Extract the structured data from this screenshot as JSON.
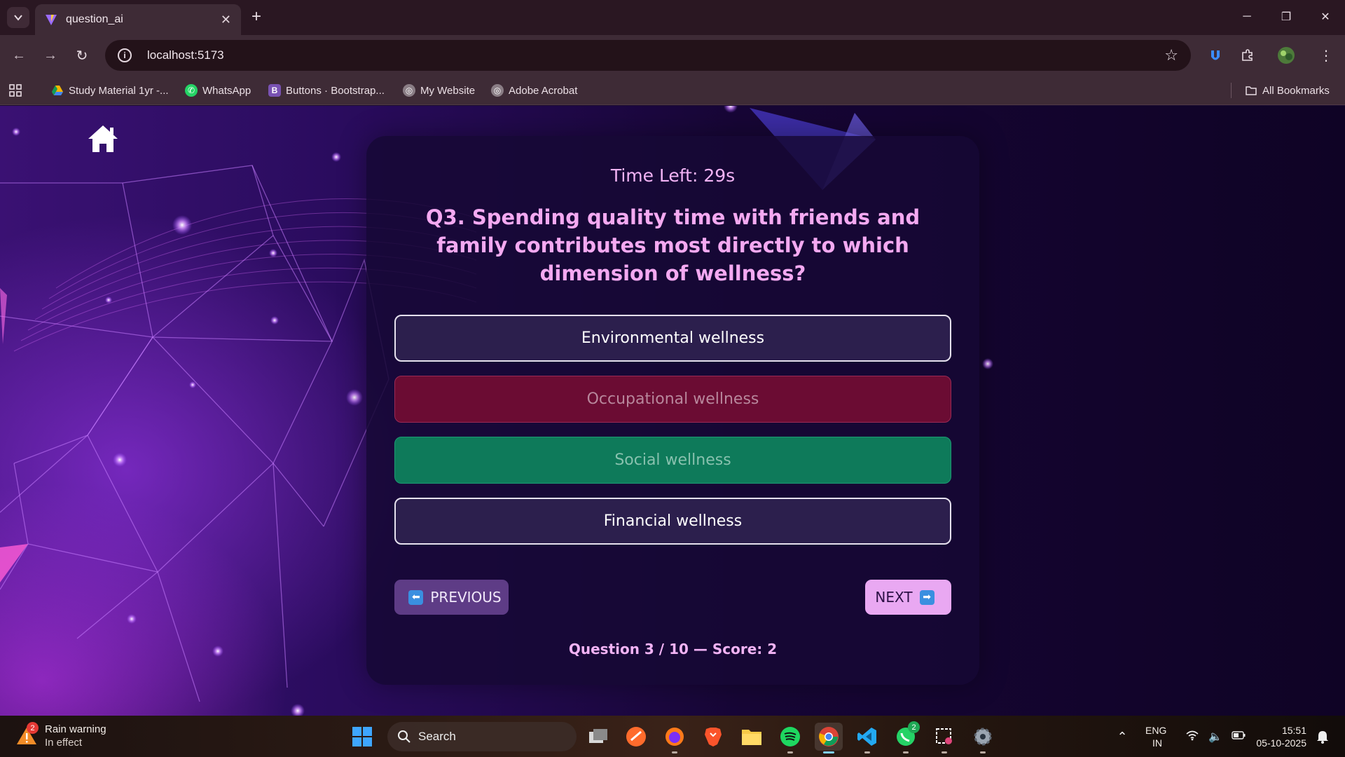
{
  "browser": {
    "tab_title": "question_ai",
    "url": "localhost:5173",
    "bookmarks": [
      "Study Material 1yr -...",
      "WhatsApp",
      "Buttons · Bootstrap...",
      "My Website",
      "Adobe Acrobat"
    ],
    "all_bookmarks_label": "All Bookmarks"
  },
  "quiz": {
    "timer": "Time Left: 29s",
    "question": "Q3. Spending quality time with friends and family contributes most directly to which dimension of wellness?",
    "options": [
      {
        "label": "Environmental wellness",
        "state": "neutral"
      },
      {
        "label": "Occupational wellness",
        "state": "wrong"
      },
      {
        "label": "Social wellness",
        "state": "correct"
      },
      {
        "label": "Financial wellness",
        "state": "neutral"
      }
    ],
    "prev_label": "PREVIOUS",
    "next_label": "NEXT",
    "progress": "Question 3 / 10 — Score: 2"
  },
  "taskbar": {
    "weather_title": "Rain warning",
    "weather_sub": "In effect",
    "weather_badge": "2",
    "search_label": "Search",
    "whatsapp_badge": "2",
    "lang_line1": "ENG",
    "lang_line2": "IN",
    "time": "15:51",
    "date": "05-10-2025"
  },
  "colors": {
    "accent_pink": "#f2b3f5",
    "wrong_red": "#6b0c33",
    "correct_green": "#0e7a5a",
    "next_button": "#e9a8f2"
  }
}
